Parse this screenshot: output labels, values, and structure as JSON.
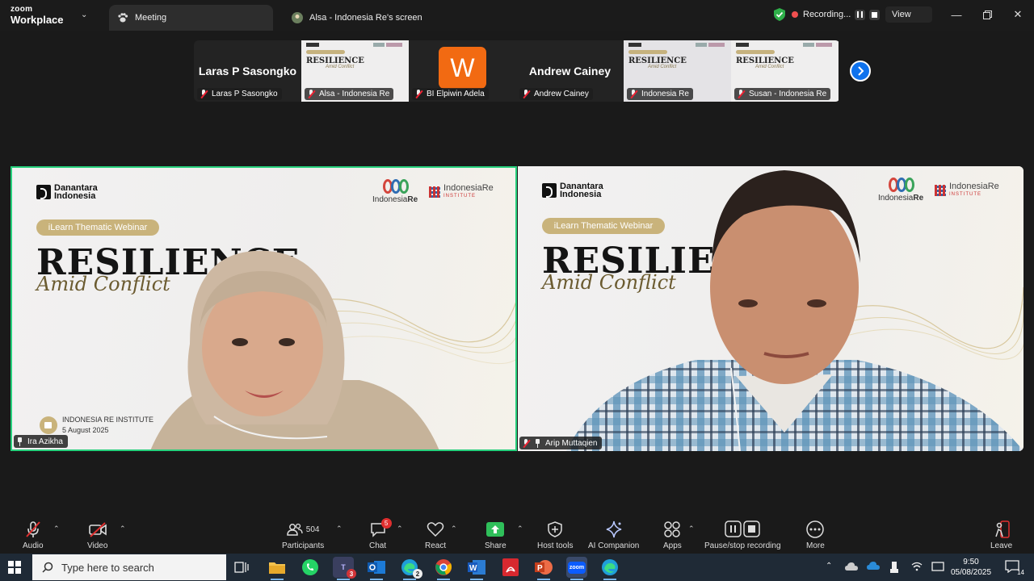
{
  "app": {
    "logo_line1": "zoom",
    "logo_line2": "Workplace"
  },
  "tabs": [
    {
      "label": "Meeting",
      "active": true
    },
    {
      "label": "Alsa - Indonesia Re's screen",
      "active": false
    }
  ],
  "recording": {
    "label": "Recording..."
  },
  "view_label": "View",
  "gallery_strip": [
    {
      "big_name": "Laras P Sasongko",
      "label": "Laras P Sasongko",
      "type": "name"
    },
    {
      "big_name": "",
      "label": "Alsa - Indonesia Re",
      "type": "slide",
      "slide_title": "RESILIENCE",
      "slide_sub": "Amid Conflict"
    },
    {
      "big_name": "",
      "label": "BI Elpiwin Adela",
      "type": "avatar",
      "avatar_letter": "W"
    },
    {
      "big_name": "Andrew Cainey",
      "label": "Andrew Cainey",
      "type": "name"
    },
    {
      "big_name": "",
      "label": "Indonesia Re",
      "type": "slide",
      "slide_title": "RESILIENCE",
      "slide_sub": "Amid Conflict"
    },
    {
      "big_name": "",
      "label": "Susan - Indonesia Re",
      "type": "slide",
      "slide_title": "RESILIENCE",
      "slide_sub": "Amid Conflict"
    }
  ],
  "videos": {
    "left": {
      "name": "Ira Azikha",
      "brand": "Danantara\nIndonesia",
      "brand_l1": "Danantara",
      "brand_l2": "Indonesia",
      "ire_name_a": "Indonesia",
      "ire_name_b": "Re",
      "iri_name": "IndonesiaRe",
      "iri_sub": "INSTITUTE",
      "pill": "iLearn Thematic Webinar",
      "title": "RESILIENCE",
      "subtitle": "Amid Conflict",
      "institute": "INDONESIA RE INSTITUTE",
      "date": "5 August 2025"
    },
    "right": {
      "name": "Arip Muttaqien",
      "brand_l1": "Danantara",
      "brand_l2": "Indonesia",
      "ire_name_a": "Indonesia",
      "ire_name_b": "Re",
      "iri_name": "IndonesiaRe",
      "iri_sub": "INSTITUTE",
      "pill": "iLearn Thematic Webinar",
      "title": "RESILIE",
      "subtitle": "Amid Conflict"
    }
  },
  "toolbar": {
    "audio": "Audio",
    "video": "Video",
    "participants": "Participants",
    "participants_count": "504",
    "chat": "Chat",
    "chat_badge": "5",
    "react": "React",
    "share": "Share",
    "host_tools": "Host tools",
    "ai_companion": "AI Companion",
    "apps": "Apps",
    "pause_stop": "Pause/stop recording",
    "more": "More",
    "leave": "Leave"
  },
  "taskbar": {
    "search_placeholder": "Type here to search",
    "teams_badge": "3",
    "edge2_badge": "2",
    "zoom_label": "zoom",
    "time": "9:50",
    "date": "05/08/2025",
    "notif_count": "14"
  },
  "colors": {
    "accent_blue": "#0e72ed",
    "speaker_border": "#26d07c",
    "gold": "#c9b37b",
    "record_red": "#f04f4f"
  }
}
